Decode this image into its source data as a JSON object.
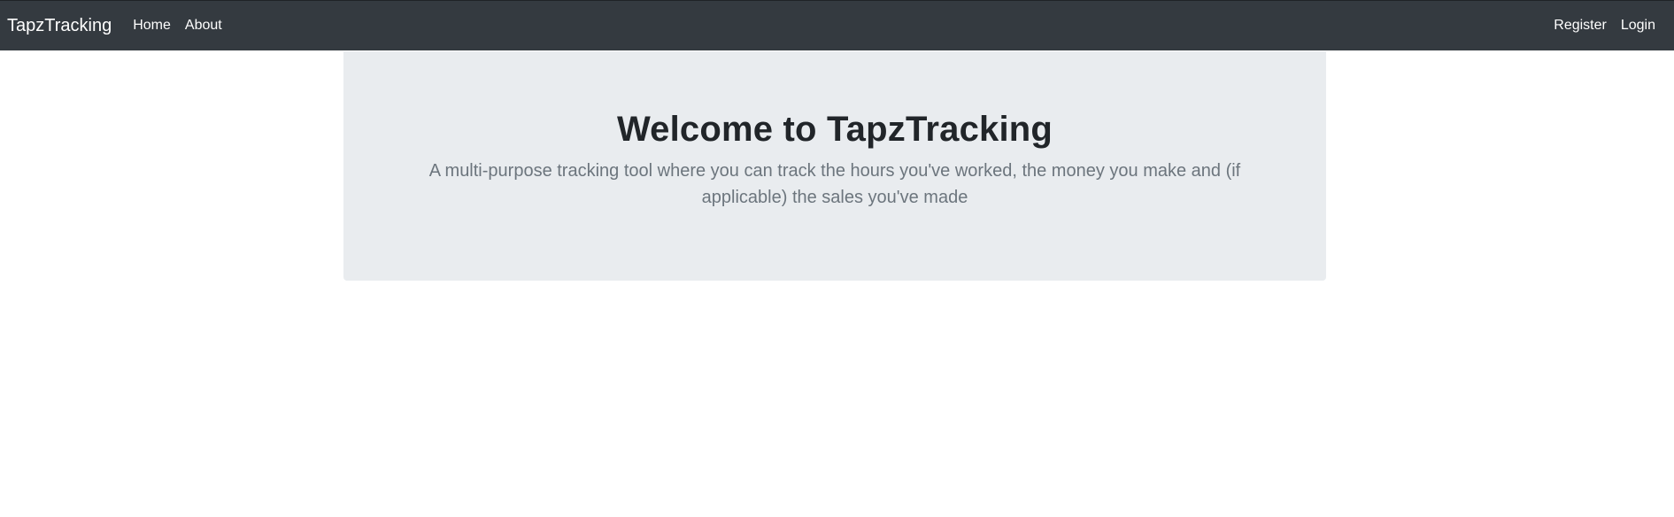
{
  "navbar": {
    "brand": "TapzTracking",
    "left_links": [
      {
        "label": "Home"
      },
      {
        "label": "About"
      }
    ],
    "right_links": [
      {
        "label": "Register"
      },
      {
        "label": "Login"
      }
    ],
    "background_color": "#343a40"
  },
  "hero": {
    "title": "Welcome to TapzTracking",
    "lead": "A multi-purpose tracking tool where you can track the hours you've worked, the money you make and (if applicable) the sales you've made",
    "background_color": "#e9ecef"
  }
}
